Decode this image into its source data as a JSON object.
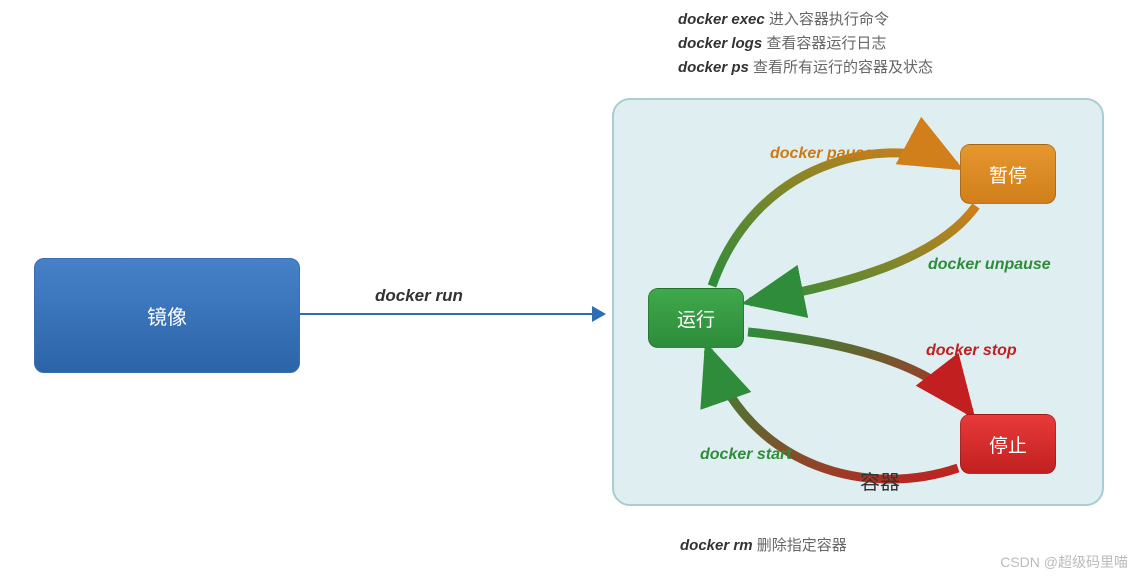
{
  "top_labels": [
    {
      "cmd": "docker exec",
      "desc": "进入容器执行命令"
    },
    {
      "cmd": "docker logs",
      "desc": "查看容器运行日志"
    },
    {
      "cmd": "docker ps",
      "desc": "查看所有运行的容器及状态"
    }
  ],
  "image_box": "镜像",
  "run_cmd": "docker run",
  "states": {
    "run": "运行",
    "pause": "暂停",
    "stop": "停止"
  },
  "transitions": {
    "pause": "docker pause",
    "unpause": "docker unpause",
    "stop": "docker stop",
    "start": "docker start"
  },
  "container_title": "容器",
  "rm": {
    "cmd": "docker rm",
    "desc": "删除指定容器"
  },
  "watermark": "CSDN @超级码里喵"
}
